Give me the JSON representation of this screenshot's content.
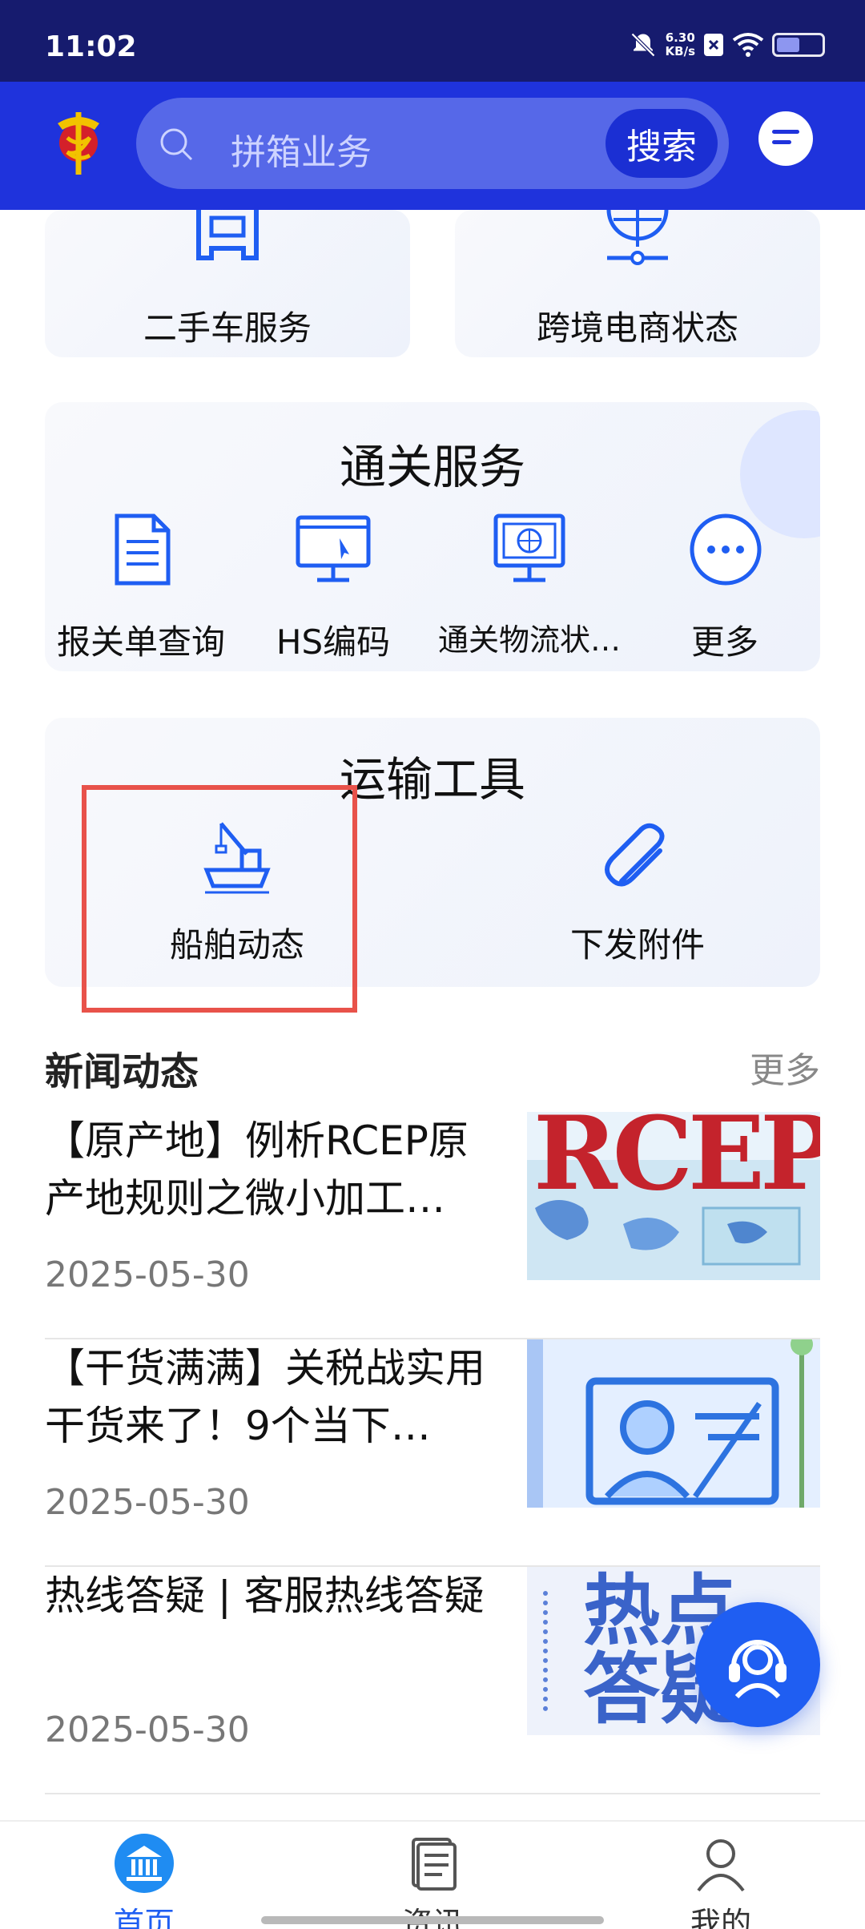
{
  "status_bar": {
    "time": "11:02",
    "net_speed_value": "6.30",
    "net_speed_unit": "KB/s"
  },
  "header": {
    "search_placeholder": "拼箱业务",
    "search_button": "搜索"
  },
  "top_cards": [
    {
      "label": "二手车服务",
      "icon": "car-icon"
    },
    {
      "label": "跨境电商状态",
      "icon": "globe-icon"
    }
  ],
  "customs_section": {
    "title": "通关服务",
    "items": [
      {
        "label": "报关单查询",
        "icon": "document-icon"
      },
      {
        "label": "HS编码",
        "icon": "monitor-icon"
      },
      {
        "label": "通关物流状…",
        "icon": "globe-monitor-icon"
      },
      {
        "label": "更多",
        "icon": "more-icon"
      }
    ]
  },
  "transport_section": {
    "title": "运输工具",
    "items": [
      {
        "label": "船舶动态",
        "icon": "ship-icon"
      },
      {
        "label": "下发附件",
        "icon": "paperclip-icon"
      }
    ]
  },
  "news": {
    "title": "新闻动态",
    "more": "更多",
    "items": [
      {
        "title": "【原产地】例析RCEP原产地规则之微小加工…",
        "date": "2025-05-30",
        "thumb_text": "RCEP"
      },
      {
        "title": "【干货满满】关税战实用干货来了！9个当下…",
        "date": "2025-05-30",
        "thumb_text": ""
      },
      {
        "title": "热线答疑 | 客服热线答疑",
        "date": "2025-05-30",
        "thumb_text": "热点答疑"
      }
    ]
  },
  "bottom_nav": [
    {
      "label": "首页",
      "icon": "bank-icon",
      "active": true
    },
    {
      "label": "资讯",
      "icon": "news-icon",
      "active": false
    },
    {
      "label": "我的",
      "icon": "user-icon",
      "active": false
    }
  ],
  "colors": {
    "brand_blue": "#1f33dc",
    "accent": "#1f5ef2",
    "highlight": "#e8524a"
  }
}
